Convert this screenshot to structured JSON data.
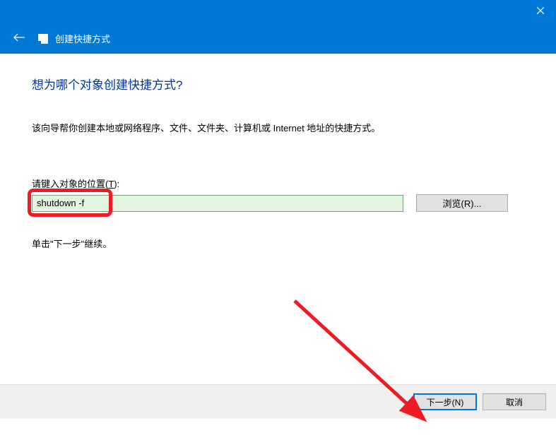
{
  "titlebar": {
    "wizard_title": "创建快捷方式"
  },
  "main": {
    "heading": "想为哪个对象创建快捷方式?",
    "description": "该向导帮你创建本地或网络程序、文件、文件夹、计算机或 Internet 地址的快捷方式。",
    "field_label_prefix": "请键入对象的位置(",
    "field_label_key": "T",
    "field_label_suffix": "):",
    "input_value": "shutdown -f",
    "browse_label": "浏览(R)...",
    "continue_text": "单击\"下一步\"继续。"
  },
  "footer": {
    "next_label": "下一步(N)",
    "cancel_label": "取消"
  }
}
